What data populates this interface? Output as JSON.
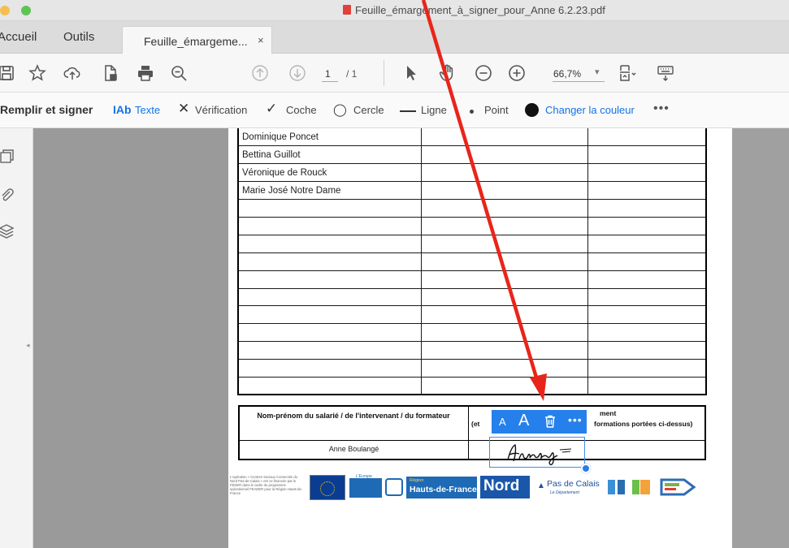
{
  "window": {
    "title": "Feuille_émargement_à_signer_pour_Anne 6.2.23.pdf"
  },
  "tabs": {
    "home": "Accueil",
    "tools": "Outils",
    "document": "Feuille_émargeme...",
    "close": "×"
  },
  "toolbar": {
    "icons": [
      "save-icon",
      "bookmark-star-icon",
      "cloud-upload-icon",
      "file-lock-icon",
      "print-icon",
      "zoom-out-magnifier-icon",
      "page-up-icon",
      "page-down-icon",
      "cursor-arrow-icon",
      "hand-icon",
      "zoom-minus-icon",
      "zoom-plus-icon",
      "page-fit-icon",
      "keyboard-icon"
    ],
    "page_current": "1",
    "page_total": "/ 1",
    "zoom": "66,7%",
    "zoom_caret": "▾"
  },
  "fill_sign": {
    "title": "Remplir et signer",
    "text_icon": "IAb",
    "text_tool": "Texte",
    "check_glyph": "✕",
    "verification": "Vérification",
    "tick_glyph": "✓",
    "coche": "Coche",
    "circle_glyph": "◯",
    "cercle": "Cercle",
    "ligne": "Ligne",
    "point": "Point",
    "change_color": "Changer la couleur",
    "more": "•••"
  },
  "table": {
    "names": [
      "Dominique Poncet",
      "Bettina Guillot",
      "Véronique de Rouck",
      "Marie José Notre Dame",
      "",
      "",
      "",
      "",
      "",
      "",
      "",
      "",
      "",
      "",
      ""
    ]
  },
  "form": {
    "head_left": "Nom-prénom du salarié / de l'intervenant / du formateur",
    "head_right_a": "ment",
    "head_right_b": "(et",
    "head_right_c": "formations portées ci-dessus)",
    "name": "Anne Boulangé"
  },
  "logos": {
    "small_text": "L'opération « Centres Sociaux Connectés du Nord Pas-de-Calais » est co-financée par le FEDER dans le cadre du programme opérationnel FEADER pour la Région Hauts-de-France",
    "europe_top": "L'Europe",
    "region_small": "Région",
    "region_big": "Hauts-de-France",
    "nord": "Nord",
    "pdc_main": "Pas de Calais",
    "pdc_sub": "Le Département"
  },
  "float_bar": {
    "small_a": "A",
    "big_a": "A",
    "more": "•••"
  },
  "colors": {
    "accent": "#2680eb",
    "annotation_arrow": "#e8251a"
  }
}
